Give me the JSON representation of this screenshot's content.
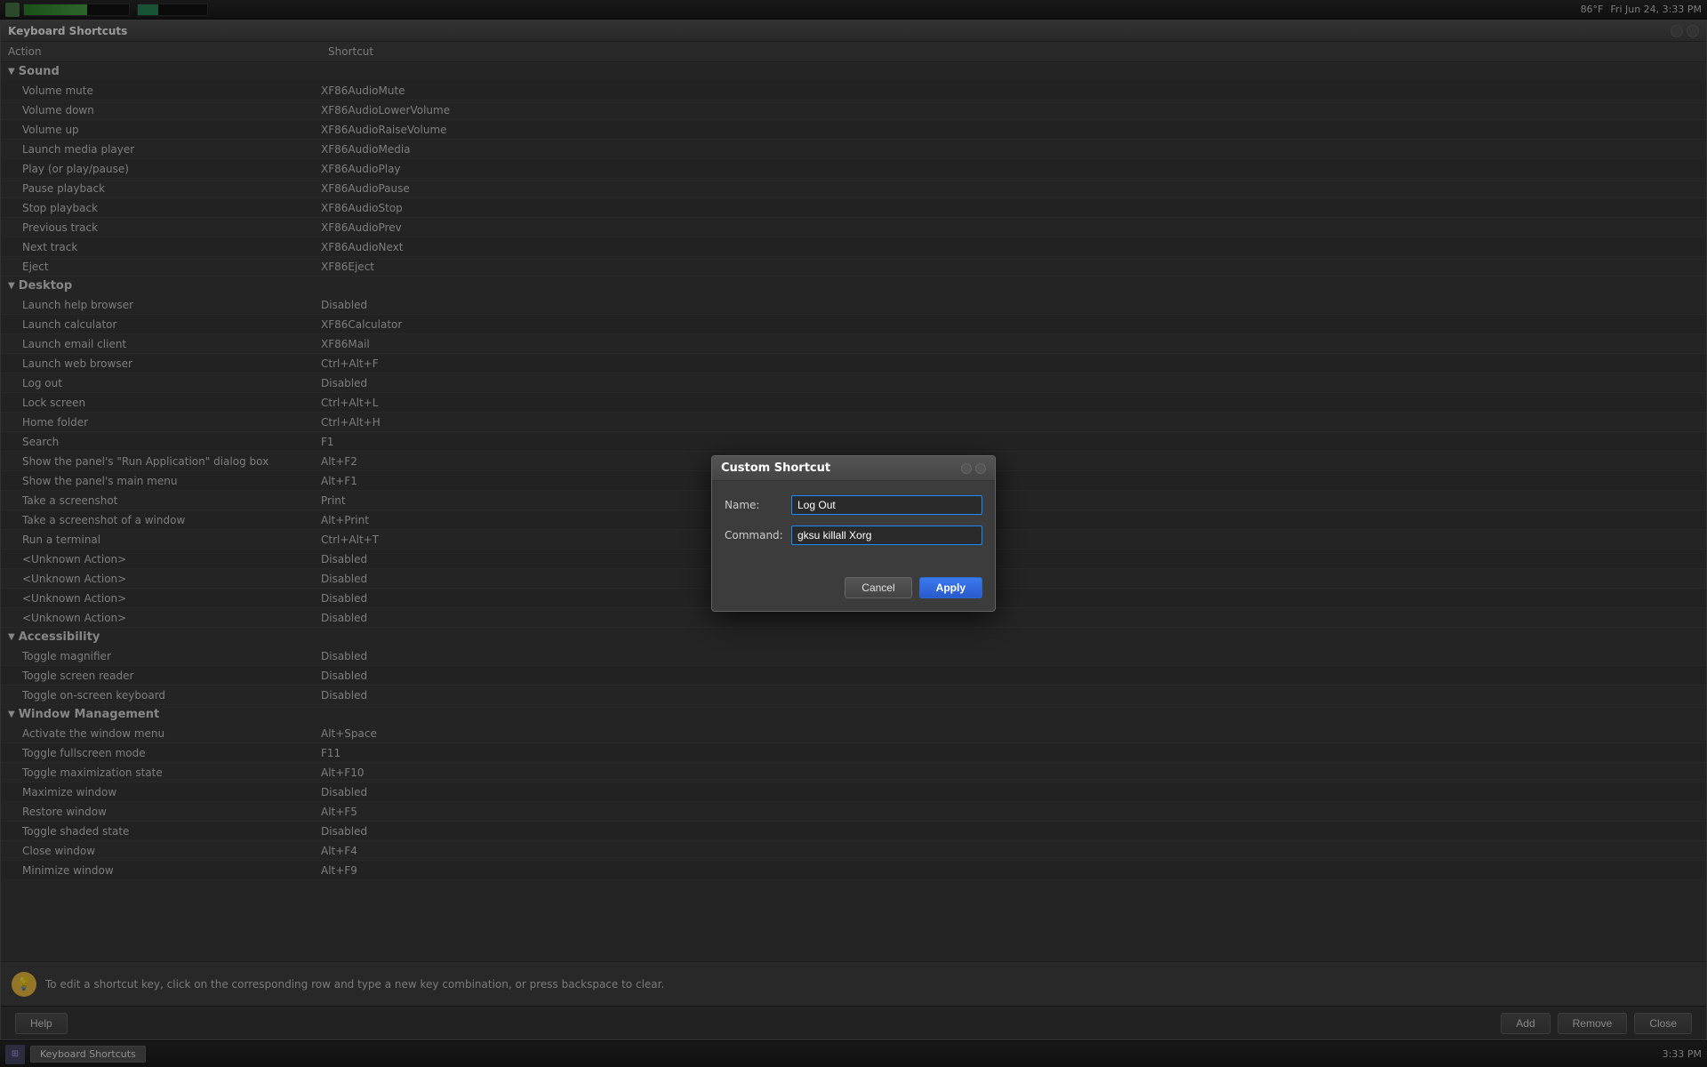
{
  "taskbar": {
    "title": "Keyboard Shortcuts",
    "time": "Fri Jun 24, 3:33 PM",
    "temp": "86°F"
  },
  "window": {
    "title": "Keyboard Shortcuts",
    "columns": {
      "action": "Action",
      "shortcut": "Shortcut"
    }
  },
  "sections": [
    {
      "name": "Sound",
      "items": [
        {
          "action": "Volume mute",
          "shortcut": "XF86AudioMute"
        },
        {
          "action": "Volume down",
          "shortcut": "XF86AudioLowerVolume"
        },
        {
          "action": "Volume up",
          "shortcut": "XF86AudioRaiseVolume"
        },
        {
          "action": "Launch media player",
          "shortcut": "XF86AudioMedia"
        },
        {
          "action": "Play (or play/pause)",
          "shortcut": "XF86AudioPlay"
        },
        {
          "action": "Pause playback",
          "shortcut": "XF86AudioPause"
        },
        {
          "action": "Stop playback",
          "shortcut": "XF86AudioStop"
        },
        {
          "action": "Previous track",
          "shortcut": "XF86AudioPrev"
        },
        {
          "action": "Next track",
          "shortcut": "XF86AudioNext"
        },
        {
          "action": "Eject",
          "shortcut": "XF86Eject"
        }
      ]
    },
    {
      "name": "Desktop",
      "items": [
        {
          "action": "Launch help browser",
          "shortcut": "Disabled"
        },
        {
          "action": "Launch calculator",
          "shortcut": "XF86Calculator"
        },
        {
          "action": "Launch email client",
          "shortcut": "XF86Mail"
        },
        {
          "action": "Launch web browser",
          "shortcut": "Ctrl+Alt+F"
        },
        {
          "action": "Log out",
          "shortcut": "Disabled"
        },
        {
          "action": "Lock screen",
          "shortcut": "Ctrl+Alt+L"
        },
        {
          "action": "Home folder",
          "shortcut": "Ctrl+Alt+H"
        },
        {
          "action": "Search",
          "shortcut": "F1"
        },
        {
          "action": "Show the panel's \"Run Application\" dialog box",
          "shortcut": "Alt+F2"
        },
        {
          "action": "Show the panel's main menu",
          "shortcut": "Alt+F1"
        },
        {
          "action": "Take a screenshot",
          "shortcut": "Print"
        },
        {
          "action": "Take a screenshot of a window",
          "shortcut": "Alt+Print"
        },
        {
          "action": "Run a terminal",
          "shortcut": "Ctrl+Alt+T"
        },
        {
          "action": "<Unknown Action>",
          "shortcut": "Disabled"
        },
        {
          "action": "<Unknown Action>",
          "shortcut": "Disabled"
        },
        {
          "action": "<Unknown Action>",
          "shortcut": "Disabled"
        },
        {
          "action": "<Unknown Action>",
          "shortcut": "Disabled"
        }
      ]
    },
    {
      "name": "Accessibility",
      "items": [
        {
          "action": "Toggle magnifier",
          "shortcut": "Disabled"
        },
        {
          "action": "Toggle screen reader",
          "shortcut": "Disabled"
        },
        {
          "action": "Toggle on-screen keyboard",
          "shortcut": "Disabled"
        }
      ]
    },
    {
      "name": "Window Management",
      "items": [
        {
          "action": "Activate the window menu",
          "shortcut": "Alt+Space"
        },
        {
          "action": "Toggle fullscreen mode",
          "shortcut": "F11"
        },
        {
          "action": "Toggle maximization state",
          "shortcut": "Alt+F10"
        },
        {
          "action": "Maximize window",
          "shortcut": "Disabled"
        },
        {
          "action": "Restore window",
          "shortcut": "Alt+F5"
        },
        {
          "action": "Toggle shaded state",
          "shortcut": "Disabled"
        },
        {
          "action": "Close window",
          "shortcut": "Alt+F4"
        },
        {
          "action": "Minimize window",
          "shortcut": "Alt+F9"
        }
      ]
    }
  ],
  "bottom_tip": "To edit a shortcut key, click on the corresponding row and type a new key combination, or press backspace to clear.",
  "buttons": {
    "help": "Help",
    "add": "Add",
    "remove": "Remove",
    "close": "Close"
  },
  "modal": {
    "title": "Custom Shortcut",
    "name_label": "Name:",
    "name_value": "Log Out",
    "command_label": "Command:",
    "command_value": "gksu killall Xorg",
    "cancel_label": "Cancel",
    "apply_label": "Apply"
  },
  "bottom_taskbar": {
    "app_label": "Keyboard Shortcuts"
  }
}
